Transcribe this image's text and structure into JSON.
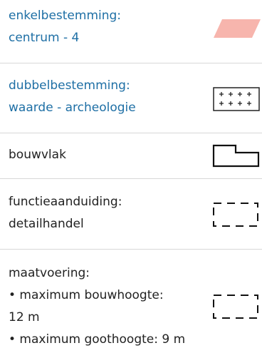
{
  "legend": {
    "items": [
      {
        "lines": [
          "enkelbestemming:",
          "centrum - 4"
        ],
        "symbol": "pink-parallelogram-icon",
        "text_color": "#1e6fa5",
        "symbol_color": "#f7b5ad"
      },
      {
        "lines": [
          "dubbelbestemming:",
          "waarde - archeologie"
        ],
        "symbol": "plus-grid-icon",
        "text_color": "#1e6fa5"
      },
      {
        "lines": [
          "bouwvlak"
        ],
        "symbol": "building-plane-icon",
        "text_color": "#222222"
      },
      {
        "lines": [
          "functieaanduiding:",
          "detailhandel"
        ],
        "symbol": "dashed-rectangle-icon",
        "text_color": "#222222"
      },
      {
        "lines": [
          "maatvoering:",
          "• maximum bouwhoogte:",
          "12 m",
          "• maximum goothoogte: 9 m"
        ],
        "symbol": "dashed-rectangle-icon",
        "text_color": "#222222"
      }
    ]
  }
}
